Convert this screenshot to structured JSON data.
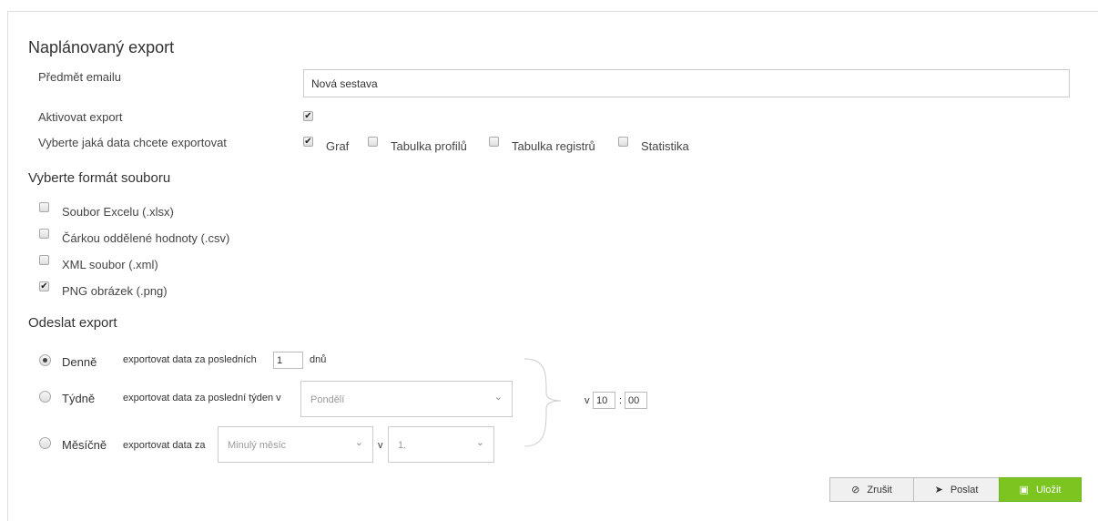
{
  "title": "Naplánovaný export",
  "email_subject": {
    "label": "Předmět emailu",
    "value": "Nová sestava"
  },
  "activate": {
    "label": "Aktivovat export",
    "checked": true
  },
  "data_select": {
    "label": "Vyberte jaká data chcete exportovat",
    "options": [
      {
        "label": "Graf",
        "checked": true
      },
      {
        "label": "Tabulka profilů",
        "checked": false
      },
      {
        "label": "Tabulka registrů",
        "checked": false
      },
      {
        "label": "Statistika",
        "checked": false
      }
    ]
  },
  "file_format": {
    "title": "Vyberte formát souboru",
    "options": [
      {
        "label": "Soubor Excelu (.xlsx)",
        "checked": false
      },
      {
        "label": "Čárkou oddělené hodnoty (.csv)",
        "checked": false
      },
      {
        "label": "XML soubor (.xml)",
        "checked": false
      },
      {
        "label": "PNG obrázek (.png)",
        "checked": true
      }
    ]
  },
  "send": {
    "title": "Odeslat export",
    "daily": {
      "label": "Denně",
      "selected": true,
      "text": "exportovat data za posledních",
      "days_value": "1",
      "unit": "dnů"
    },
    "weekly": {
      "label": "Týdně",
      "selected": false,
      "text": "exportovat data za poslední týden v",
      "day_value": "Pondělí"
    },
    "monthly": {
      "label": "Měsíčně",
      "selected": false,
      "text": "exportovat data za",
      "month_value": "Minulý měsíc",
      "v": "v",
      "day_value": "1."
    },
    "time": {
      "prefix": "v",
      "hours": "10",
      "separator": ":",
      "minutes": "00"
    }
  },
  "buttons": {
    "cancel": "Zrušit",
    "send": "Poslat",
    "save": "Uložit"
  },
  "colors": {
    "save_button": "#7cc520"
  },
  "icons": {
    "cancel": "cancel-circle-icon",
    "send": "paper-plane-icon",
    "save": "floppy-disk-icon"
  }
}
